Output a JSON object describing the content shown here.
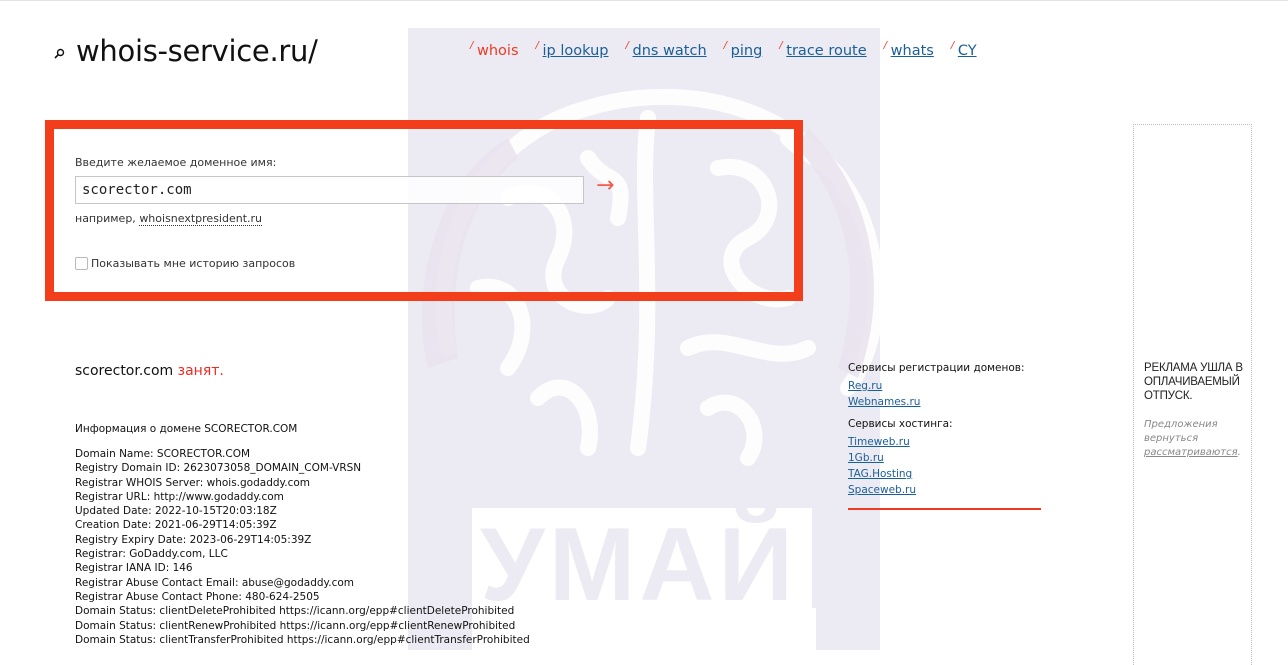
{
  "header": {
    "logo_icon": "search-magnifier-icon",
    "site_title": "whois-service.ru/",
    "nav_separator": "/",
    "nav": [
      {
        "label": "whois",
        "active": true
      },
      {
        "label": "ip lookup",
        "active": false
      },
      {
        "label": "dns watch",
        "active": false
      },
      {
        "label": "ping",
        "active": false
      },
      {
        "label": "trace route",
        "active": false
      },
      {
        "label": "whats",
        "active": false
      },
      {
        "label": "CY",
        "active": false
      }
    ]
  },
  "search": {
    "label": "Введите желаемое доменное имя:",
    "value": "scorector.com",
    "submit_icon": "arrow-right-icon",
    "submit_glyph": "→",
    "example_prefix": "например, ",
    "example_link": "whoisnextpresident.ru",
    "history_checkbox_label": "Показывать мне историю запросов",
    "history_checked": false,
    "highlight_color": "#f23e1a"
  },
  "result": {
    "domain": "scorector.com",
    "status": "занят.",
    "info_title": "Информация о домене SCORECTOR.COM",
    "whois_lines": [
      "Domain Name: SCORECTOR.COM",
      "Registry Domain ID: 2623073058_DOMAIN_COM-VRSN",
      "Registrar WHOIS Server: whois.godaddy.com",
      "Registrar URL: http://www.godaddy.com",
      "Updated Date: 2022-10-15T20:03:18Z",
      "Creation Date: 2021-06-29T14:05:39Z",
      "Registry Expiry Date: 2023-06-29T14:05:39Z",
      "Registrar: GoDaddy.com, LLC",
      "Registrar IANA ID: 146",
      "Registrar Abuse Contact Email: abuse@godaddy.com",
      "Registrar Abuse Contact Phone: 480-624-2505",
      "Domain Status: clientDeleteProhibited https://icann.org/epp#clientDeleteProhibited",
      "Domain Status: clientRenewProhibited https://icann.org/epp#clientRenewProhibited",
      "Domain Status: clientTransferProhibited https://icann.org/epp#clientTransferProhibited"
    ]
  },
  "services": {
    "registration_title": "Сервисы регистрации доменов:",
    "registration_links": [
      "Reg.ru",
      "Webnames.ru"
    ],
    "hosting_title": "Сервисы хостинга:",
    "hosting_links": [
      "Timeweb.ru",
      "1Gb.ru",
      "TAG.Hosting",
      "Spaceweb.ru"
    ]
  },
  "ad": {
    "title": "РЕКЛАМА УШЛА В ОПЛАЧИВАЕМЫЙ ОТПУСК.",
    "sub_prefix": "Предложения вернуться ",
    "sub_link": "рассматриваются",
    "sub_suffix": "."
  },
  "watermark": {
    "text": "УМАЙ",
    "icon": "brain-logo-icon"
  }
}
